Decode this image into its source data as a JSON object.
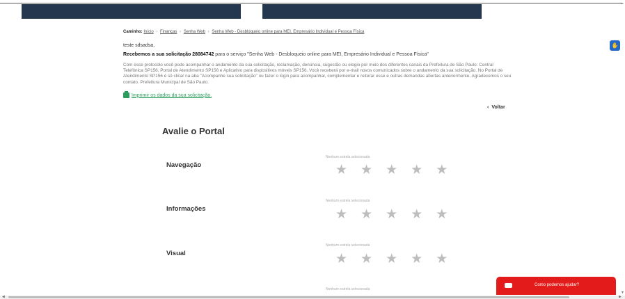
{
  "breadcrumb": {
    "label": "Caminho:",
    "items": [
      "Início",
      "Finanças",
      "Senha Web",
      "Senha Web - Desbloqueio online para MEI, Empresário Individual e Pessoa Física"
    ],
    "sep": "›"
  },
  "message": {
    "greeting": "teste sdsadsa,",
    "received_bold": "Recebemos a sua solicitação 28084742",
    "received_rest": " para o serviço \"Senha Web - Desbloqueio online para MEI, Empresário Individual e Pessoa Física\"",
    "paragraph": "Com esse protocolo você pode acompanhar o andamento da sua solicitação, reclamação, denúncia, sugestão ou elogio por meio dos diferentes canais da Prefeitura de São Paulo: Central Telefônica SP156, Portal de Atendimento SP156 e Aplicativo para dispositivos móveis SP156. Você receberá por e-mail novos comunicados sobre o andamento da sua solicitação. No Portal de Atendimento SP156 é só clicar na aba \"Acompanhe sua solicitação\" ou fazer o login para acompanhar, complementar e reiterar esse e outras demandas abertas anteriormente. Agradecemos o seu contato. Prefeitura Municipal de São Paulo.",
    "print_link": "Imprimir os dados da sua solicitação."
  },
  "back": {
    "label": "Voltar",
    "icon": "chevron-left-icon"
  },
  "rating": {
    "title": "Avalie o Portal",
    "none_selected": "Nenhum estrela selecionada",
    "criteria": [
      {
        "label": "Navegação",
        "stars": 5,
        "selected": 0
      },
      {
        "label": "Informações",
        "stars": 5,
        "selected": 0
      },
      {
        "label": "Visual",
        "stars": 5,
        "selected": 0
      }
    ]
  },
  "chat": {
    "label": "Como podemos ajudar?",
    "icon": "chat-bubble-icon"
  },
  "colors": {
    "header": "#24374f",
    "link_green": "#2a9d5c",
    "chat_red": "#e31b1b",
    "star_gray": "#bdbdbd",
    "badge_blue": "#2269c9"
  }
}
